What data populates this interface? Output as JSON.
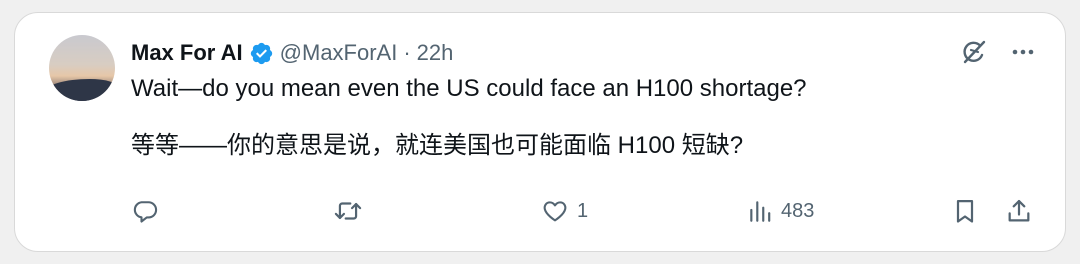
{
  "post": {
    "author_name": "Max For AI",
    "handle": "@MaxForAI",
    "separator": "·",
    "time": "22h",
    "text_en": "Wait—do you mean even the US could face an H100 shortage?",
    "text_zh": "等等——你的意思是说，就连美国也可能面临 H100 短缺?"
  },
  "actions": {
    "reply_count": "",
    "repost_count": "",
    "like_count": "1",
    "view_count": "483"
  },
  "icons": {
    "verified": "verified-badge-icon",
    "grok": "grok-icon",
    "more": "more-horizontal-icon",
    "reply": "reply-icon",
    "repost": "repost-icon",
    "like": "heart-icon",
    "views": "views-bar-chart-icon",
    "bookmark": "bookmark-icon",
    "share": "share-icon"
  },
  "colors": {
    "verified_blue": "#1d9bf0",
    "text_primary": "#0f1419",
    "text_secondary": "#536471"
  }
}
